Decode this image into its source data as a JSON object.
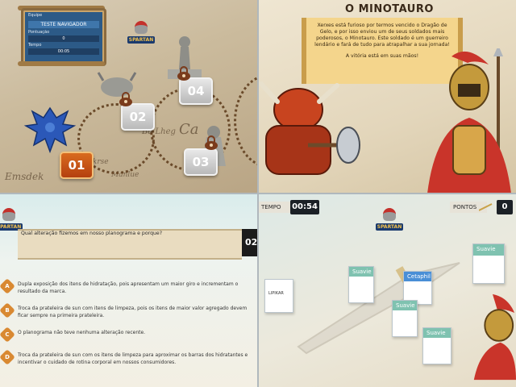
{
  "q1": {
    "scroll": {
      "title_label": "Equipe",
      "title_value": "TESTE NAVIGADOR",
      "score_label": "Pontuação",
      "score_value": "0",
      "time_label": "Tempo",
      "time_value": "00:05"
    },
    "emblem": "SPARTAN",
    "levels": [
      {
        "label": "01",
        "state": "open"
      },
      {
        "label": "02",
        "state": "locked"
      },
      {
        "label": "03",
        "state": "locked"
      },
      {
        "label": "04",
        "state": "locked"
      }
    ],
    "map_words": [
      "Emsdek",
      "Ba Lheg",
      "Ca",
      "Manlue",
      "lkrse"
    ],
    "colors": {
      "open": "#c9561a",
      "locked": "#c9c9c9",
      "lock": "#7a3b1c"
    }
  },
  "q2": {
    "title": "O MINOTAURO",
    "paragraph1": "Xerxes está furioso por termos vencido o Dragão de Gelo, e por isso enviou um de seus soldados mais poderosos, o Minotauro. Este soldado é um guerreiro lendário e fará de tudo para atrapalhar a sua jornada!",
    "paragraph2": "A vitória está em suas mãos!"
  },
  "q3": {
    "emblem": "SPARTAN",
    "question": "Qual alteração fizemos em nosso planograma e porque?",
    "timer": "02",
    "options": [
      {
        "letter": "A",
        "text": "Dupla exposição dos itens de hidratação, pois apresentam um maior giro e incrementam o resultado da marca."
      },
      {
        "letter": "B",
        "text": "Troca da prateleira de sun com itens de limpeza, pois os itens de maior valor agregado devem ficar sempre na primeira prateleira."
      },
      {
        "letter": "C",
        "text": "O planograma não teve nenhuma alteração recente."
      },
      {
        "letter": "D",
        "text": "Troca da prateleira de sun com os itens de limpeza para aproximar os barras dos hidratantes e incentivar o cuidado de rotina corporal em nossos consumidores."
      }
    ]
  },
  "q4": {
    "time_label": "TEMPO",
    "time_value": "00:54",
    "points_label": "PONTOS",
    "points_value": "0",
    "emblem": "SPARTAN",
    "products": [
      {
        "brand": "Suavie"
      },
      {
        "brand": "Suavie"
      },
      {
        "brand": "Cetaphil"
      },
      {
        "brand": "Suavie"
      },
      {
        "brand": "Suavie"
      },
      {
        "brand": "LIPIKAR"
      }
    ]
  }
}
